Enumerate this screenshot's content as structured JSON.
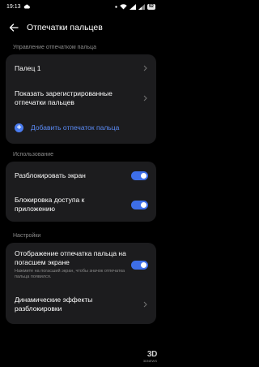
{
  "status": {
    "time": "19:13",
    "battery": "92"
  },
  "header": {
    "title": "Отпечатки пальцев"
  },
  "section_manage": {
    "label": "Управление отпечатком пальца",
    "items": [
      {
        "label": "Палец 1"
      },
      {
        "label": "Показать зарегистрированные отпечатки пальцев"
      }
    ],
    "add_label": "Добавить отпечаток пальца"
  },
  "section_usage": {
    "label": "Использование",
    "items": [
      {
        "label": "Разблокировать экран",
        "enabled": true
      },
      {
        "label": "Блокировка доступа к приложению",
        "enabled": true
      }
    ]
  },
  "section_settings": {
    "label": "Настройки",
    "items": [
      {
        "label": "Отображение отпечатка пальца на погасшем экране",
        "sublabel": "Нажмите на погасший экран, чтобы значок отпечатка пальца появился.",
        "enabled": true
      },
      {
        "label": "Динамические эффекты разблокировки"
      }
    ]
  },
  "watermark": {
    "logo": "3D",
    "text": "3DNEWS"
  },
  "colors": {
    "accent": "#3d6ee8",
    "card": "#1c1c1e",
    "background": "#000000"
  }
}
